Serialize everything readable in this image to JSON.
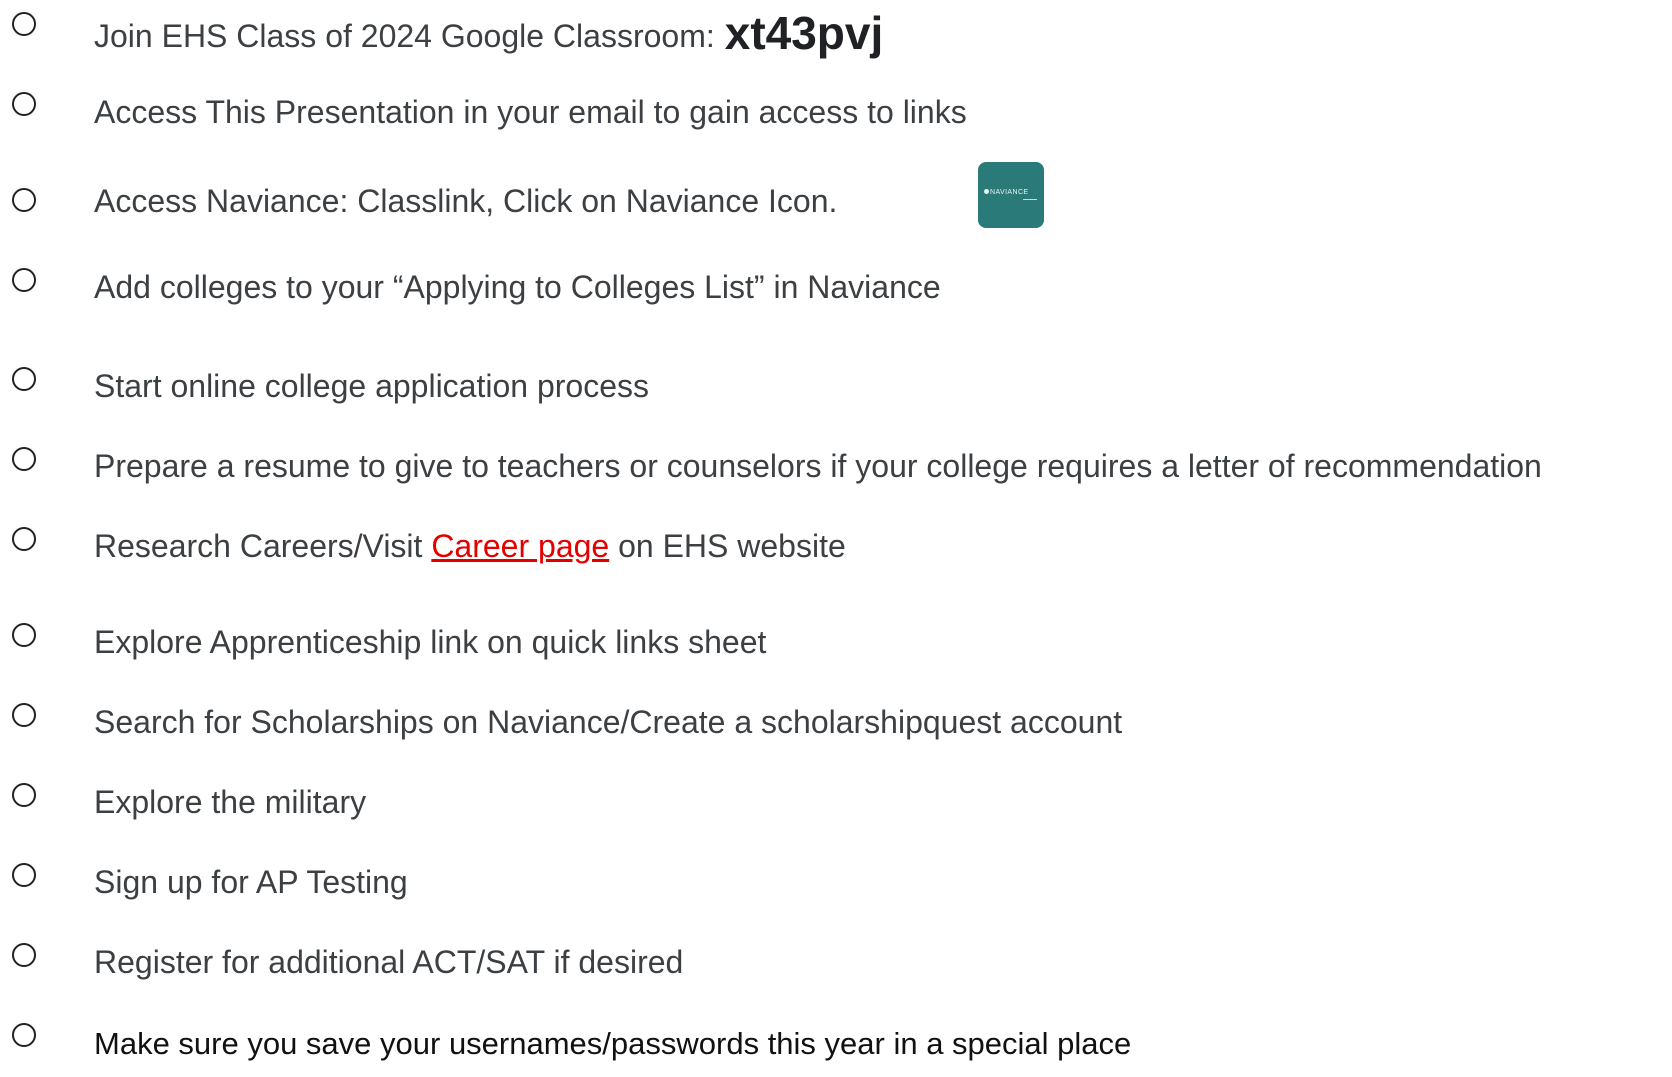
{
  "checklist": {
    "item_1": {
      "label": "Join EHS Class of 2024 Google Classroom:",
      "code": "xt43pvj"
    },
    "item_2": {
      "label": "Access This Presentation in your email to gain access to links"
    },
    "item_3": {
      "label": "Access Naviance:  Classlink, Click on Naviance Icon.",
      "icon": "naviance-app-icon",
      "icon_text": "NAVIANCE",
      "icon_color": "#2a7a7a"
    },
    "item_4": {
      "label": "Add colleges to your “Applying to Colleges List” in Naviance"
    },
    "item_5": {
      "label": "Start online college application process"
    },
    "item_6": {
      "label": "Prepare a resume to give to teachers or counselors if your college requires a letter of recommendation"
    },
    "item_7": {
      "prefix": "Research Careers/Visit",
      "link": "Career page",
      "suffix": "on EHS website",
      "link_color": "#e50000"
    },
    "item_8": {
      "label": "Explore Apprenticeship link on quick links sheet"
    },
    "item_9": {
      "label": "Search for Scholarships on Naviance/Create a scholarshipquest account"
    },
    "item_10": {
      "label": "Explore the military"
    },
    "item_11": {
      "label": "Sign up for AP Testing"
    },
    "item_12": {
      "label": "Register for additional ACT/SAT if desired"
    },
    "item_13": {
      "label": "Make sure you save your usernames/passwords this year in a special place"
    }
  }
}
